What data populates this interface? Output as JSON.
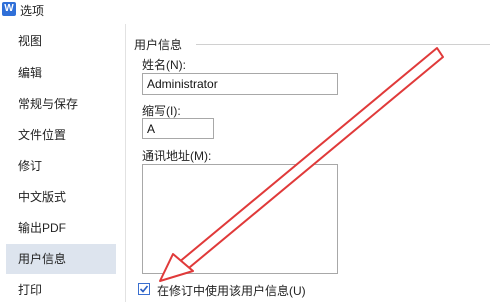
{
  "window": {
    "title": "选项",
    "app_icon_glyph": "W",
    "app_icon_color": "#2f6fd8"
  },
  "sidebar": {
    "items": [
      {
        "label": "视图"
      },
      {
        "label": "编辑"
      },
      {
        "label": "常规与保存"
      },
      {
        "label": "文件位置"
      },
      {
        "label": "修订"
      },
      {
        "label": "中文版式"
      },
      {
        "label": "输出PDF"
      },
      {
        "label": "用户信息",
        "active": true
      },
      {
        "label": "打印"
      }
    ],
    "active_bg": "#dde4ee"
  },
  "user_info": {
    "group_title": "用户信息",
    "name_label": "姓名(N):",
    "name_value": "Administrator",
    "initials_label": "缩写(I):",
    "initials_value": "A",
    "address_label": "通讯地址(M):",
    "address_value": "",
    "checkbox_label": "在修订中使用该用户信息(U)",
    "checkbox_checked": true
  },
  "annotation": {
    "arrow_color": "#e03a3a",
    "icon": "red-arrow-annotation"
  }
}
